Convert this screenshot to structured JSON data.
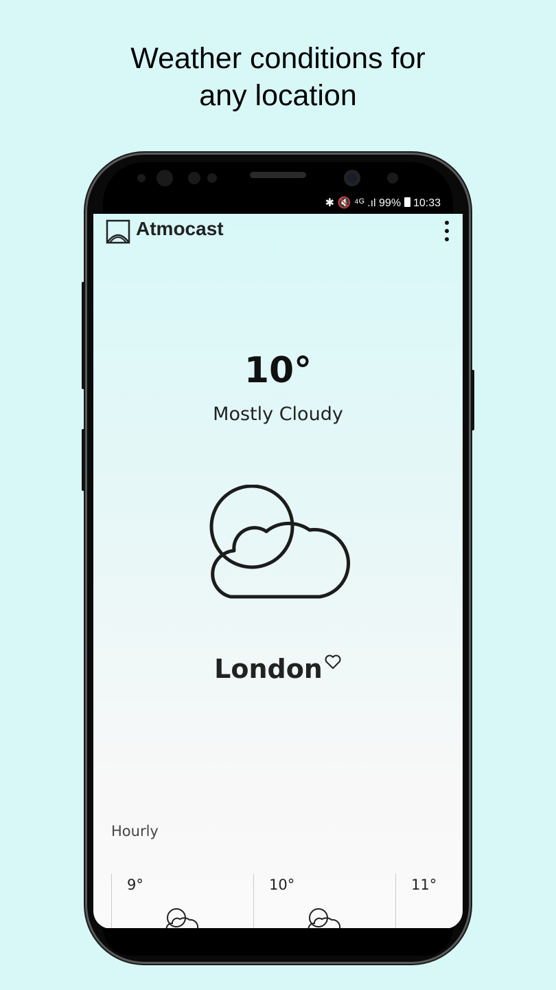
{
  "headline": {
    "line1": "Weather conditions for",
    "line2": "any location"
  },
  "status_bar": {
    "icons_text": "✱ 🔇 ⁴ᴳ .ıl",
    "battery": "99%",
    "time": "10:33"
  },
  "app": {
    "title": "Atmocast",
    "logo_icon": "atmocast-logo-icon",
    "menu_icon": "more-vert-icon"
  },
  "current": {
    "temperature": "10°",
    "condition": "Mostly Cloudy",
    "icon": "mostly-cloudy-icon",
    "city": "London",
    "favorite_icon": "heart-outline-icon"
  },
  "hourly": {
    "label": "Hourly",
    "items": [
      {
        "temp": "9°",
        "icon": "mostly-cloudy-icon"
      },
      {
        "temp": "10°",
        "icon": "mostly-cloudy-icon"
      },
      {
        "temp": "11°",
        "icon": "mostly-cloudy-icon"
      }
    ]
  },
  "colors": {
    "background": "#d8f8f8",
    "text": "#111111"
  }
}
